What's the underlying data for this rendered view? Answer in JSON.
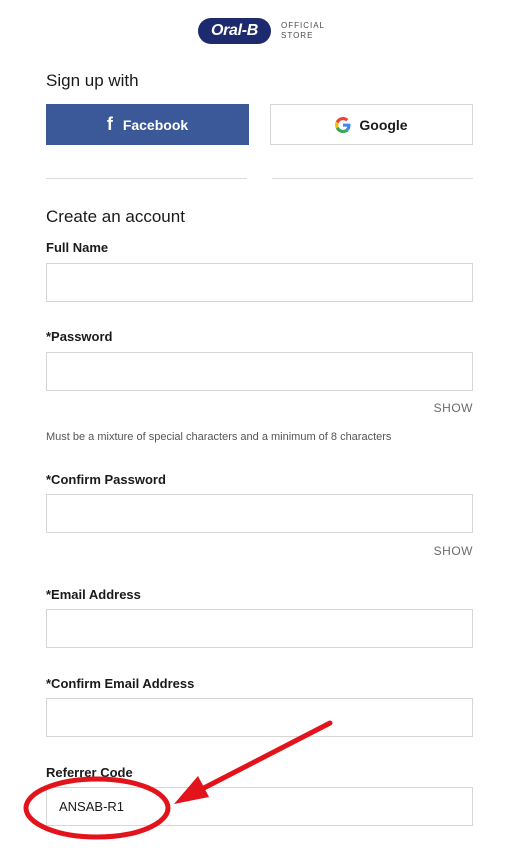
{
  "brand": {
    "logo_text": "Oral-B",
    "store_line1": "OFFICIAL",
    "store_line2": "STORE"
  },
  "signup": {
    "title": "Sign up with",
    "facebook_label": "Facebook",
    "google_label": "Google"
  },
  "account": {
    "title": "Create an account",
    "full_name_label": "Full Name",
    "password_label": "*Password",
    "password_show": "SHOW",
    "password_hint": "Must be a mixture of special characters and a minimum of 8 characters",
    "confirm_password_label": "*Confirm Password",
    "confirm_password_show": "SHOW",
    "email_label": "*Email Address",
    "confirm_email_label": "*Confirm Email Address",
    "referrer_label": "Referrer Code",
    "referrer_value": "ANSAB-R1"
  },
  "colors": {
    "brand_navy": "#1e2a6e",
    "facebook_blue": "#3b5998",
    "annotation_red": "#e3131b"
  },
  "icons": {
    "facebook": "facebook-icon",
    "google": "google-icon"
  }
}
